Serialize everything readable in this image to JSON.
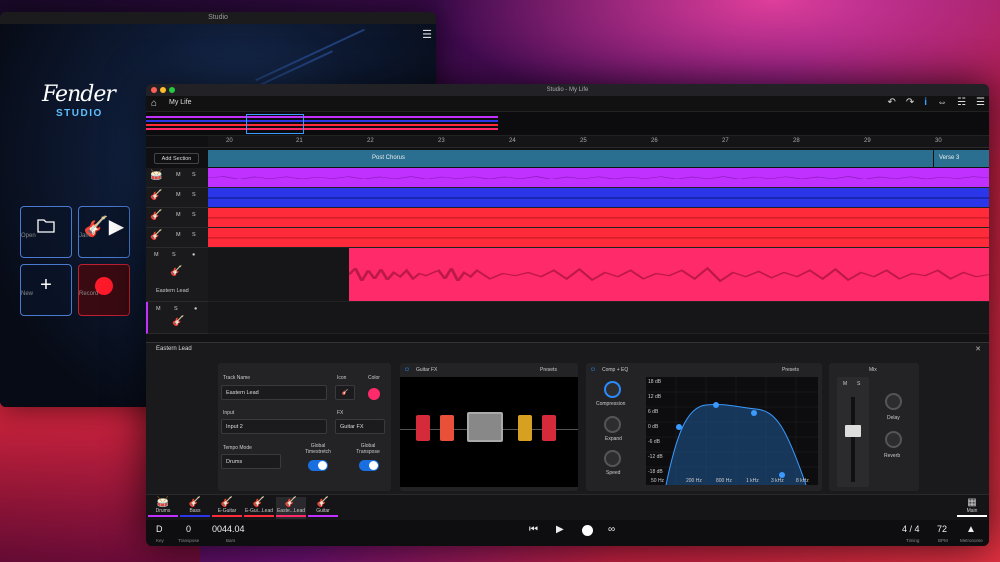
{
  "back_window": {
    "title": "Studio",
    "logo": "Fender",
    "logo_sub": "STUDIO",
    "tiles": [
      {
        "label": "Open",
        "icon": "folder-icon"
      },
      {
        "label": "Jam",
        "icon": "guitar-play-icon"
      },
      {
        "label": "New",
        "icon": "plus-icon"
      },
      {
        "label": "Record",
        "icon": "record-icon"
      }
    ]
  },
  "window": {
    "title": "Studio - My Life",
    "song_name": "My Life"
  },
  "ruler": {
    "bars": [
      "20",
      "21",
      "22",
      "23",
      "24",
      "25",
      "26",
      "27",
      "28",
      "29",
      "30"
    ]
  },
  "sections": {
    "add_label": "Add Section",
    "items": [
      {
        "label": "Post Chorus"
      },
      {
        "label": "Verse 3"
      }
    ]
  },
  "tracks": [
    {
      "m": "M",
      "s": "S",
      "color": "#c030ff"
    },
    {
      "m": "M",
      "s": "S",
      "color": "#2a36e8"
    },
    {
      "m": "M",
      "s": "S",
      "color": "#ff2a3a"
    },
    {
      "m": "M",
      "s": "S",
      "color": "#ff2a3a"
    },
    {
      "m": "M",
      "s": "S",
      "color": "#ff2a6a",
      "name": "Eastern Lead"
    },
    {
      "m": "M",
      "s": "S",
      "color": "#c030ff"
    }
  ],
  "editor": {
    "track_title": "Eastern Lead",
    "track_name_label": "Track Name",
    "track_name_value": "Eastern Lead",
    "icon_label": "Icon",
    "color_label": "Color",
    "input_label": "Input",
    "input_value": "Input 2",
    "fx_label": "FX",
    "fx_value": "Guitar FX",
    "tempo_label": "Tempo Mode",
    "tempo_value": "Drums",
    "global_timestretch": "Global\nTimestretch",
    "global_transpose": "Global\nTranspose",
    "guitar_fx_title": "Guitar FX",
    "presets": "Presets",
    "comp_eq_title": "Comp + EQ",
    "compression": "Compression",
    "expand": "Expand",
    "speed": "Speed",
    "eq_db": [
      "18 dB",
      "12 dB",
      "6 dB",
      "0 dB",
      "-6 dB",
      "-12 dB",
      "-18 dB"
    ],
    "eq_hz": [
      "50 Hz",
      "200 Hz",
      "800 Hz",
      "1 kHz",
      "3 kHz",
      "8 kHz"
    ],
    "mix_title": "Mix",
    "mix_m": "M",
    "mix_s": "S",
    "delay": "Delay",
    "reverb": "Reverb"
  },
  "strip": [
    {
      "label": "Drums",
      "color": "#c030ff"
    },
    {
      "label": "Bass",
      "color": "#2a36e8"
    },
    {
      "label": "E-Guitar",
      "color": "#ff2a3a"
    },
    {
      "label": "E-Gui...Lead",
      "color": "#ff2a3a"
    },
    {
      "label": "Easte...Lead",
      "color": "#ff2a6a"
    },
    {
      "label": "Guitar",
      "color": "#c030ff"
    }
  ],
  "strip_main": "Main",
  "transport": {
    "key_value": "D",
    "key_label": "Key",
    "transpose_value": "0",
    "transpose_label": "Transpose",
    "bars_value": "0044.04",
    "bars_label": "Bars",
    "timing_value": "4 / 4",
    "timing_label": "Timing",
    "bpm_value": "72",
    "bpm_label": "BPM",
    "metronome_label": "Metronome"
  }
}
